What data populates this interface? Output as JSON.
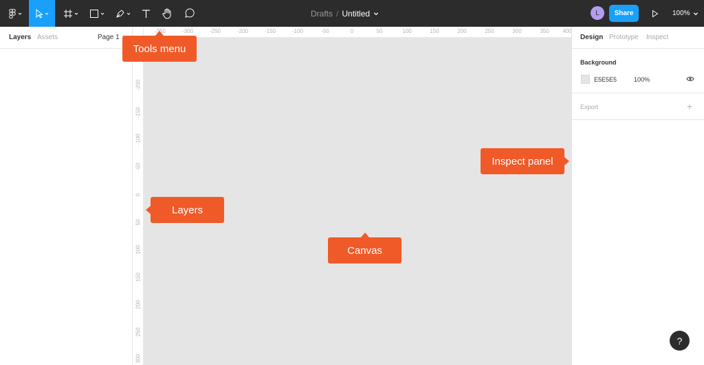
{
  "toolbar": {
    "breadcrumb_parent": "Drafts",
    "breadcrumb_separator": "/",
    "file_name": "Untitled",
    "avatar_initial": "L",
    "share_label": "Share",
    "zoom_level": "100%",
    "icons": [
      "figma-menu-icon",
      "move-tool-icon",
      "frame-tool-icon",
      "rectangle-tool-icon",
      "pen-tool-icon",
      "text-tool-icon",
      "hand-tool-icon",
      "comment-tool-icon",
      "play-icon"
    ]
  },
  "left_panel": {
    "tabs": [
      "Layers",
      "Assets"
    ],
    "page": "Page 1"
  },
  "canvas": {
    "background_color": "#E5E5E5",
    "ruler_top": [
      "-350",
      "-300",
      "-250",
      "-200",
      "-150",
      "-100",
      "-50",
      "0",
      "50",
      "100",
      "150",
      "200",
      "250",
      "300",
      "350",
      "400"
    ],
    "ruler_left": [
      "-200",
      "-150",
      "-100",
      "-50",
      "0",
      "50",
      "100",
      "150",
      "200",
      "250",
      "300"
    ]
  },
  "right_panel": {
    "tabs": [
      "Design",
      "Prototype",
      "Inspect"
    ],
    "background_title": "Background",
    "background_hex": "E5E5E5",
    "background_opacity": "100%",
    "export_title": "Export",
    "export_add": "+"
  },
  "callouts": {
    "tools": "Tools menu",
    "layers": "Layers",
    "canvas": "Canvas",
    "inspect": "Inspect panel"
  },
  "help_label": "?",
  "colors": {
    "toolbar_bg": "#2C2C2C",
    "accent_blue": "#18A0FB",
    "callout_orange": "#F05A28",
    "canvas_bg": "#E5E5E5"
  }
}
